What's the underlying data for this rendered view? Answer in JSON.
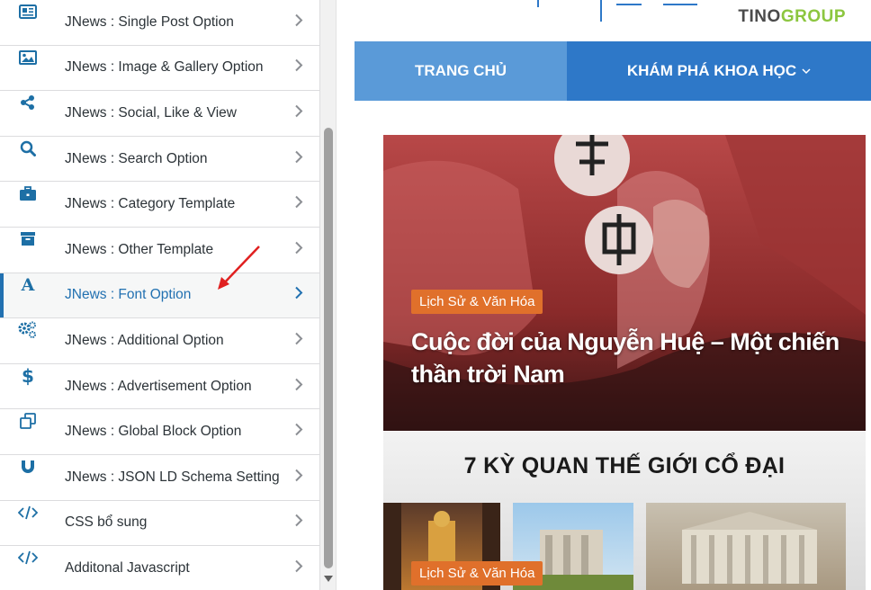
{
  "customizer": {
    "items": [
      {
        "label": "JNews : Single Post Option",
        "icon": "single-post-icon"
      },
      {
        "label": "JNews : Image & Gallery Option",
        "icon": "image-icon"
      },
      {
        "label": "JNews : Social, Like & View",
        "icon": "share-icon"
      },
      {
        "label": "JNews : Search Option",
        "icon": "search-icon"
      },
      {
        "label": "JNews : Category Template",
        "icon": "briefcase-icon"
      },
      {
        "label": "JNews : Other Template",
        "icon": "archive-icon"
      },
      {
        "label": "JNews : Font Option",
        "icon": "font-icon",
        "active": true
      },
      {
        "label": "JNews : Additional Option",
        "icon": "gears-icon"
      },
      {
        "label": "JNews : Advertisement Option",
        "icon": "dollar-icon"
      },
      {
        "label": "JNews : Global Block Option",
        "icon": "clone-icon"
      },
      {
        "label": "JNews : JSON LD Schema Setting",
        "icon": "magnet-icon"
      },
      {
        "label": "CSS bổ sung",
        "icon": "code-icon"
      },
      {
        "label": "Additonal Javascript",
        "icon": "code-icon"
      }
    ]
  },
  "preview": {
    "brand_part1": "TINO",
    "brand_part2": "GROUP",
    "nav": {
      "home": "TRANG CHỦ",
      "explore": "KHÁM PHÁ KHOA HỌC"
    },
    "hero": {
      "badge": "Lịch Sử & Văn Hóa",
      "title": "Cuộc đời của Nguyễn Huệ – Một chiến thần trời Nam"
    },
    "card2": {
      "title": "7 KỲ QUAN THẾ GIỚI CỔ ĐẠI",
      "badge": "Lịch Sử & Văn Hóa"
    }
  },
  "colors": {
    "accent": "#2271b1",
    "nav_bg": "#2e78c8",
    "nav_home_bg": "#5a9ad8",
    "badge": "#e0702b",
    "brand_green": "#8cc63f"
  }
}
